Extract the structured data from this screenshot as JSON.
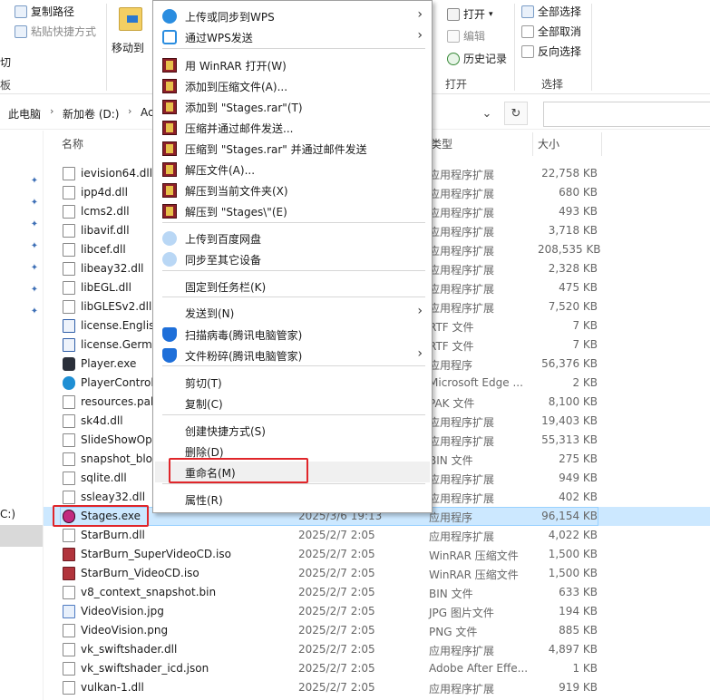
{
  "ribbon": {
    "clipboard_items": [
      "复制路径",
      "粘贴快捷方式"
    ],
    "partial_labels": [
      "切",
      "板"
    ],
    "move_to": "移动到",
    "open_group": {
      "open": "打开",
      "edit": "编辑",
      "history": "历史记录",
      "label": "打开"
    },
    "select_group": {
      "select_all": "全部选择",
      "select_none": "全部取消",
      "invert": "反向选择",
      "label": "选择"
    }
  },
  "address": {
    "crumbs": [
      "此电脑",
      "新加卷 (D:)",
      "Ac"
    ],
    "refresh_icon": "refresh-icon",
    "chevron_icon": "chevron-down-icon"
  },
  "nav": {
    "drive_partial": "C:)"
  },
  "columns": {
    "name": "名称",
    "type": "类型",
    "size": "大小"
  },
  "files": [
    {
      "name": "ievision64.dll",
      "date": "",
      "type": "应用程序扩展",
      "size": "22,758 KB",
      "icon": "dll"
    },
    {
      "name": "ipp4d.dll",
      "date": "",
      "type": "应用程序扩展",
      "size": "680 KB",
      "icon": "dll"
    },
    {
      "name": "lcms2.dll",
      "date": "",
      "type": "应用程序扩展",
      "size": "493 KB",
      "icon": "dll"
    },
    {
      "name": "libavif.dll",
      "date": "",
      "type": "应用程序扩展",
      "size": "3,718 KB",
      "icon": "dll"
    },
    {
      "name": "libcef.dll",
      "date": "",
      "type": "应用程序扩展",
      "size": "208,535 KB",
      "icon": "dll"
    },
    {
      "name": "libeay32.dll",
      "date": "",
      "type": "应用程序扩展",
      "size": "2,328 KB",
      "icon": "dll"
    },
    {
      "name": "libEGL.dll",
      "date": "",
      "type": "应用程序扩展",
      "size": "475 KB",
      "icon": "dll"
    },
    {
      "name": "libGLESv2.dll",
      "date": "",
      "type": "应用程序扩展",
      "size": "7,520 KB",
      "icon": "dll"
    },
    {
      "name": "license.English",
      "date": "",
      "type": "RTF 文件",
      "size": "7 KB",
      "icon": "doc"
    },
    {
      "name": "license.Germa",
      "date": "",
      "type": "RTF 文件",
      "size": "7 KB",
      "icon": "doc"
    },
    {
      "name": "Player.exe",
      "date": "",
      "type": "应用程序",
      "size": "56,376 KB",
      "icon": "exe"
    },
    {
      "name": "PlayerControl",
      "date": "",
      "type": "Microsoft Edge ...",
      "size": "2 KB",
      "icon": "edge"
    },
    {
      "name": "resources.pak",
      "date": "",
      "type": "PAK 文件",
      "size": "8,100 KB",
      "icon": "dll"
    },
    {
      "name": "sk4d.dll",
      "date": "",
      "type": "应用程序扩展",
      "size": "19,403 KB",
      "icon": "dll"
    },
    {
      "name": "SlideShowOpe",
      "date": "",
      "type": "应用程序扩展",
      "size": "55,313 KB",
      "icon": "dll"
    },
    {
      "name": "snapshot_blob",
      "date": "",
      "type": "BIN 文件",
      "size": "275 KB",
      "icon": "dll"
    },
    {
      "name": "sqlite.dll",
      "date": "",
      "type": "应用程序扩展",
      "size": "949 KB",
      "icon": "dll"
    },
    {
      "name": "ssleay32.dll",
      "date": "",
      "type": "应用程序扩展",
      "size": "402 KB",
      "icon": "dll"
    },
    {
      "name": "Stages.exe",
      "date": "2025/3/6 19:13",
      "type": "应用程序",
      "size": "96,154 KB",
      "icon": "stages"
    },
    {
      "name": "StarBurn.dll",
      "date": "2025/2/7 2:05",
      "type": "应用程序扩展",
      "size": "4,022 KB",
      "icon": "dll"
    },
    {
      "name": "StarBurn_SuperVideoCD.iso",
      "date": "2025/2/7 2:05",
      "type": "WinRAR 压缩文件",
      "size": "1,500 KB",
      "icon": "rar"
    },
    {
      "name": "StarBurn_VideoCD.iso",
      "date": "2025/2/7 2:05",
      "type": "WinRAR 压缩文件",
      "size": "1,500 KB",
      "icon": "rar"
    },
    {
      "name": "v8_context_snapshot.bin",
      "date": "2025/2/7 2:05",
      "type": "BIN 文件",
      "size": "633 KB",
      "icon": "dll"
    },
    {
      "name": "VideoVision.jpg",
      "date": "2025/2/7 2:05",
      "type": "JPG 图片文件",
      "size": "194 KB",
      "icon": "img"
    },
    {
      "name": "VideoVision.png",
      "date": "2025/2/7 2:05",
      "type": "PNG 文件",
      "size": "885 KB",
      "icon": "dll"
    },
    {
      "name": "vk_swiftshader.dll",
      "date": "2025/2/7 2:05",
      "type": "应用程序扩展",
      "size": "4,897 KB",
      "icon": "dll"
    },
    {
      "name": "vk_swiftshader_icd.json",
      "date": "2025/2/7 2:05",
      "type": "Adobe After Effe...",
      "size": "1 KB",
      "icon": "dll"
    },
    {
      "name": "vulkan-1.dll",
      "date": "2025/2/7 2:05",
      "type": "应用程序扩展",
      "size": "919 KB",
      "icon": "dll"
    }
  ],
  "selected_file": "Stages.exe",
  "context_menu": {
    "items": [
      {
        "label": "上传或同步到WPS",
        "icon": "cloud-icon",
        "submenu": true
      },
      {
        "label": "通过WPS发送",
        "icon": "share-icon",
        "submenu": true
      },
      {
        "label": "用 WinRAR 打开(W)",
        "icon": "winrar-icon",
        "submenu": false
      },
      {
        "label": "添加到压缩文件(A)...",
        "icon": "winrar-icon",
        "submenu": false
      },
      {
        "label": "添加到 \"Stages.rar\"(T)",
        "icon": "winrar-icon",
        "submenu": false
      },
      {
        "label": "压缩并通过邮件发送...",
        "icon": "winrar-icon",
        "submenu": false
      },
      {
        "label": "压缩到 \"Stages.rar\" 并通过邮件发送",
        "icon": "winrar-icon",
        "submenu": false
      },
      {
        "label": "解压文件(A)...",
        "icon": "winrar-icon",
        "submenu": false
      },
      {
        "label": "解压到当前文件夹(X)",
        "icon": "winrar-icon",
        "submenu": false
      },
      {
        "label": "解压到 \"Stages\\\"(E)",
        "icon": "winrar-icon",
        "submenu": false
      },
      {
        "label": "上传到百度网盘",
        "icon": "baidu-icon",
        "submenu": false
      },
      {
        "label": "同步至其它设备",
        "icon": "baidu-icon",
        "submenu": false
      },
      {
        "label": "固定到任务栏(K)",
        "icon": "",
        "submenu": false
      },
      {
        "label": "发送到(N)",
        "icon": "",
        "submenu": true
      },
      {
        "label": "扫描病毒(腾讯电脑管家)",
        "icon": "shield-icon",
        "submenu": false
      },
      {
        "label": "文件粉碎(腾讯电脑管家)",
        "icon": "shield-icon",
        "submenu": true
      },
      {
        "label": "剪切(T)",
        "icon": "",
        "submenu": false
      },
      {
        "label": "复制(C)",
        "icon": "",
        "submenu": false
      },
      {
        "label": "创建快捷方式(S)",
        "icon": "",
        "submenu": false
      },
      {
        "label": "删除(D)",
        "icon": "",
        "submenu": false
      },
      {
        "label": "重命名(M)",
        "icon": "",
        "submenu": false,
        "highlighted": true
      },
      {
        "label": "属性(R)",
        "icon": "",
        "submenu": false
      }
    ]
  },
  "colors": {
    "selection": "#cce8ff",
    "annotation_red": "#e0262a",
    "accent": "#2a8de0"
  }
}
